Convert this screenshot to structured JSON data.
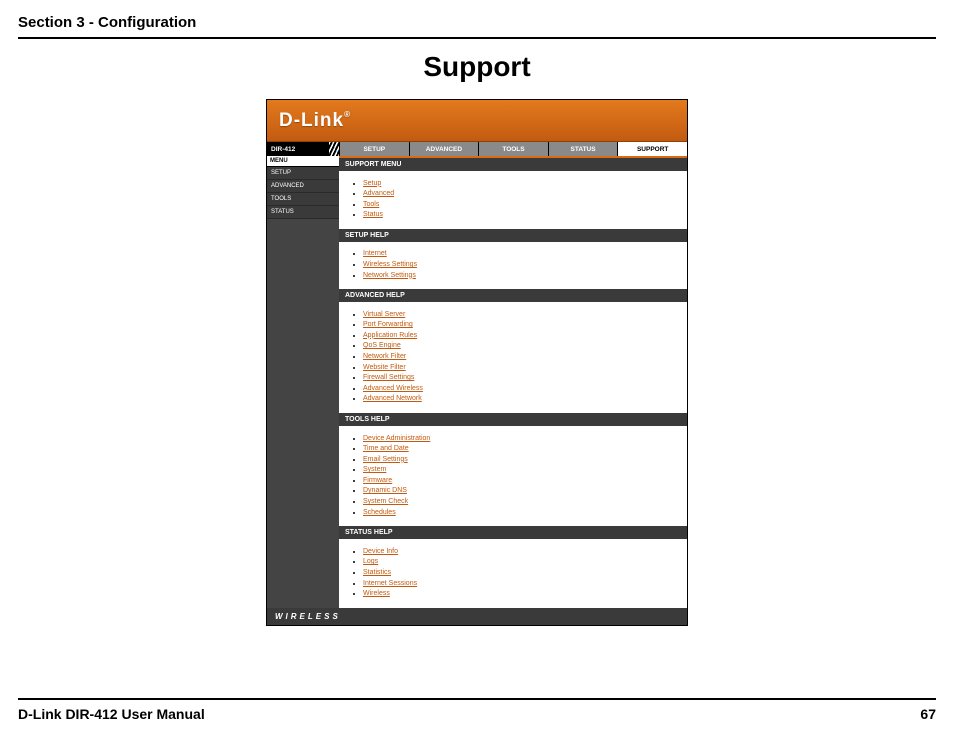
{
  "doc": {
    "section_header": "Section 3 - Configuration",
    "title": "Support",
    "footer_left": "D-Link DIR-412 User Manual",
    "footer_right": "67"
  },
  "brand": {
    "logo": "D-Link"
  },
  "model": "DIR-412",
  "tabs": {
    "setup": "SETUP",
    "advanced": "ADVANCED",
    "tools": "TOOLS",
    "status": "STATUS",
    "support": "SUPPORT"
  },
  "sidebar": {
    "header": "MENU",
    "items": {
      "setup": "SETUP",
      "advanced": "ADVANCED",
      "tools": "TOOLS",
      "status": "STATUS"
    }
  },
  "sections": {
    "support_menu": {
      "title": "SUPPORT MENU",
      "links": {
        "0": "Setup",
        "1": "Advanced",
        "2": "Tools",
        "3": "Status"
      }
    },
    "setup_help": {
      "title": "SETUP HELP",
      "links": {
        "0": "Internet",
        "1": "Wireless Settings",
        "2": "Network Settings"
      }
    },
    "advanced_help": {
      "title": "ADVANCED HELP",
      "links": {
        "0": "Virtual Server",
        "1": "Port Forwarding",
        "2": "Application Rules",
        "3": "QoS Engine",
        "4": "Network Filter",
        "5": "Website Filter",
        "6": "Firewall Settings",
        "7": "Advanced Wireless",
        "8": "Advanced Network"
      }
    },
    "tools_help": {
      "title": "TOOLS HELP",
      "links": {
        "0": "Device Administration",
        "1": "Time and Date",
        "2": "Email Settings",
        "3": "System",
        "4": "Firmware",
        "5": "Dynamic DNS",
        "6": "System Check",
        "7": "Schedules"
      }
    },
    "status_help": {
      "title": "STATUS HELP",
      "links": {
        "0": "Device Info",
        "1": "Logs",
        "2": "Statistics",
        "3": "Internet Sessions",
        "4": "Wireless"
      }
    }
  },
  "bottom_bar": "WIRELESS"
}
